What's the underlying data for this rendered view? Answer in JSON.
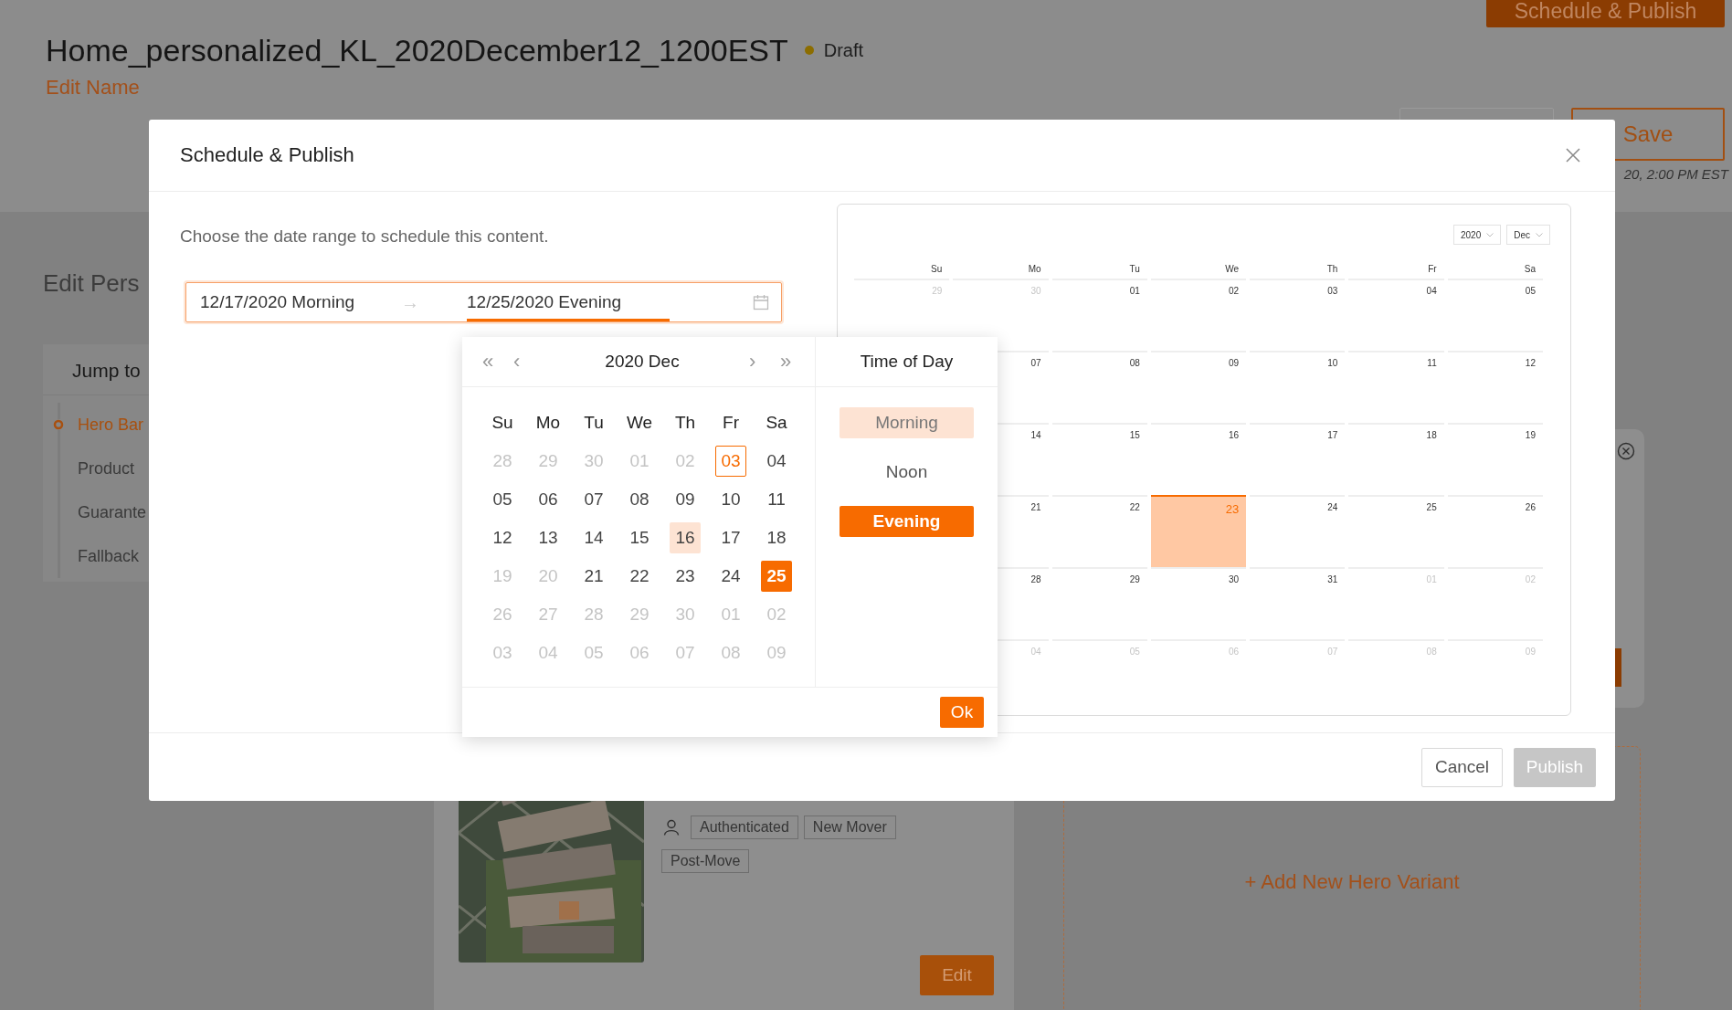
{
  "page": {
    "title": "Home_personalized_KL_2020December12_1200EST",
    "status": {
      "label": "Draft",
      "color": "#8c6d00"
    },
    "edit_link": "Edit Name",
    "schedule_button": "Schedule & Publish",
    "save_button": "Save",
    "last_saved": "20, 2:00 PM EST",
    "section_title": "Edit Pers",
    "jump_panel": {
      "title": "Jump to",
      "items": [
        {
          "label": "Hero Bar",
          "selected": true
        },
        {
          "label": "Product",
          "selected": false
        },
        {
          "label": "Guarante",
          "selected": false
        },
        {
          "label": "Fallback",
          "selected": false
        }
      ]
    },
    "hero_card": {
      "image": {
        "kind": "picture"
      },
      "tags": [
        "Authenticated",
        "New Mover",
        "Post-Move"
      ],
      "edit_button": "Edit"
    },
    "add_variant": "+ Add New Hero Variant"
  },
  "modal": {
    "title": "Schedule & Publish",
    "instruction": "Choose the date range to schedule this content.",
    "range": {
      "start": {
        "value": "12/17/2020 Morning",
        "selected": false
      },
      "separator": "→",
      "end": {
        "value": "12/25/2020 Evening",
        "selected": true
      }
    },
    "picker": {
      "nav": {
        "prev_year": "«",
        "prev_month": "‹",
        "label": "2020 Dec",
        "next_month": "›",
        "next_year": "»"
      },
      "weekdays": [
        "Su",
        "Mo",
        "Tu",
        "We",
        "Th",
        "Fr",
        "Sa"
      ],
      "days": [
        {
          "label": "28",
          "muted": true,
          "today": false,
          "hovered": false,
          "selected": false
        },
        {
          "label": "29",
          "muted": true,
          "today": false,
          "hovered": false,
          "selected": false
        },
        {
          "label": "30",
          "muted": true,
          "today": false,
          "hovered": false,
          "selected": false
        },
        {
          "label": "01",
          "muted": true,
          "today": false,
          "hovered": false,
          "selected": false
        },
        {
          "label": "02",
          "muted": true,
          "today": false,
          "hovered": false,
          "selected": false
        },
        {
          "label": "03",
          "muted": false,
          "today": true,
          "hovered": false,
          "selected": false
        },
        {
          "label": "04",
          "muted": false,
          "today": false,
          "hovered": false,
          "selected": false
        },
        {
          "label": "05",
          "muted": false,
          "today": false,
          "hovered": false,
          "selected": false
        },
        {
          "label": "06",
          "muted": false,
          "today": false,
          "hovered": false,
          "selected": false
        },
        {
          "label": "07",
          "muted": false,
          "today": false,
          "hovered": false,
          "selected": false
        },
        {
          "label": "08",
          "muted": false,
          "today": false,
          "hovered": false,
          "selected": false
        },
        {
          "label": "09",
          "muted": false,
          "today": false,
          "hovered": false,
          "selected": false
        },
        {
          "label": "10",
          "muted": false,
          "today": false,
          "hovered": false,
          "selected": false
        },
        {
          "label": "11",
          "muted": false,
          "today": false,
          "hovered": false,
          "selected": false
        },
        {
          "label": "12",
          "muted": false,
          "today": false,
          "hovered": false,
          "selected": false
        },
        {
          "label": "13",
          "muted": false,
          "today": false,
          "hovered": false,
          "selected": false
        },
        {
          "label": "14",
          "muted": false,
          "today": false,
          "hovered": false,
          "selected": false
        },
        {
          "label": "15",
          "muted": false,
          "today": false,
          "hovered": false,
          "selected": false
        },
        {
          "label": "16",
          "muted": false,
          "today": false,
          "hovered": true,
          "selected": false
        },
        {
          "label": "17",
          "muted": false,
          "today": false,
          "hovered": false,
          "selected": false
        },
        {
          "label": "18",
          "muted": false,
          "today": false,
          "hovered": false,
          "selected": false
        },
        {
          "label": "19",
          "muted": true,
          "today": false,
          "hovered": false,
          "selected": false
        },
        {
          "label": "20",
          "muted": true,
          "today": false,
          "hovered": false,
          "selected": false
        },
        {
          "label": "21",
          "muted": false,
          "today": false,
          "hovered": false,
          "selected": false
        },
        {
          "label": "22",
          "muted": false,
          "today": false,
          "hovered": false,
          "selected": false
        },
        {
          "label": "23",
          "muted": false,
          "today": false,
          "hovered": false,
          "selected": false
        },
        {
          "label": "24",
          "muted": false,
          "today": false,
          "hovered": false,
          "selected": false
        },
        {
          "label": "25",
          "muted": false,
          "today": false,
          "hovered": false,
          "selected": true
        },
        {
          "label": "26",
          "muted": true,
          "today": false,
          "hovered": false,
          "selected": false
        },
        {
          "label": "27",
          "muted": true,
          "today": false,
          "hovered": false,
          "selected": false
        },
        {
          "label": "28",
          "muted": true,
          "today": false,
          "hovered": false,
          "selected": false
        },
        {
          "label": "29",
          "muted": true,
          "today": false,
          "hovered": false,
          "selected": false
        },
        {
          "label": "30",
          "muted": true,
          "today": false,
          "hovered": false,
          "selected": false
        },
        {
          "label": "01",
          "muted": true,
          "today": false,
          "hovered": false,
          "selected": false
        },
        {
          "label": "02",
          "muted": true,
          "today": false,
          "hovered": false,
          "selected": false
        },
        {
          "label": "03",
          "muted": true,
          "today": false,
          "hovered": false,
          "selected": false
        },
        {
          "label": "04",
          "muted": true,
          "today": false,
          "hovered": false,
          "selected": false
        },
        {
          "label": "05",
          "muted": true,
          "today": false,
          "hovered": false,
          "selected": false
        },
        {
          "label": "06",
          "muted": true,
          "today": false,
          "hovered": false,
          "selected": false
        },
        {
          "label": "07",
          "muted": true,
          "today": false,
          "hovered": false,
          "selected": false
        },
        {
          "label": "08",
          "muted": true,
          "today": false,
          "hovered": false,
          "selected": false
        },
        {
          "label": "09",
          "muted": true,
          "today": false,
          "hovered": false,
          "selected": false
        }
      ],
      "time": {
        "title": "Time of Day",
        "options": [
          {
            "label": "Morning",
            "highlighted": true,
            "selected": false
          },
          {
            "label": "Noon",
            "highlighted": false,
            "selected": false
          },
          {
            "label": "Evening",
            "highlighted": false,
            "selected": true
          }
        ]
      },
      "ok_button": "Ok"
    },
    "preview": {
      "year": "2020",
      "month": "Dec",
      "columns": [
        {
          "weekday": "Su",
          "days": [
            {
              "label": "29",
              "muted": true,
              "selected": false
            }
          ]
        },
        {
          "weekday": "Mo",
          "days": [
            {
              "label": "30",
              "muted": true,
              "selected": false
            },
            {
              "label": "07",
              "muted": false,
              "selected": false
            },
            {
              "label": "14",
              "muted": false,
              "selected": false
            },
            {
              "label": "21",
              "muted": false,
              "selected": false
            },
            {
              "label": "28",
              "muted": false,
              "selected": false
            },
            {
              "label": "04",
              "muted": true,
              "selected": false
            }
          ]
        },
        {
          "weekday": "Tu",
          "days": [
            {
              "label": "01",
              "muted": false,
              "selected": false
            },
            {
              "label": "08",
              "muted": false,
              "selected": false
            },
            {
              "label": "15",
              "muted": false,
              "selected": false
            },
            {
              "label": "22",
              "muted": false,
              "selected": false
            },
            {
              "label": "29",
              "muted": false,
              "selected": false
            },
            {
              "label": "05",
              "muted": true,
              "selected": false
            }
          ]
        },
        {
          "weekday": "We",
          "days": [
            {
              "label": "02",
              "muted": false,
              "selected": false
            },
            {
              "label": "09",
              "muted": false,
              "selected": false
            },
            {
              "label": "16",
              "muted": false,
              "selected": false
            },
            {
              "label": "23",
              "muted": false,
              "selected": true
            },
            {
              "label": "30",
              "muted": false,
              "selected": false
            },
            {
              "label": "06",
              "muted": true,
              "selected": false
            }
          ]
        },
        {
          "weekday": "Th",
          "days": [
            {
              "label": "03",
              "muted": false,
              "selected": false
            },
            {
              "label": "10",
              "muted": false,
              "selected": false
            },
            {
              "label": "17",
              "muted": false,
              "selected": false
            },
            {
              "label": "24",
              "muted": false,
              "selected": false
            },
            {
              "label": "31",
              "muted": false,
              "selected": false
            },
            {
              "label": "07",
              "muted": true,
              "selected": false
            }
          ]
        },
        {
          "weekday": "Fr",
          "days": [
            {
              "label": "04",
              "muted": false,
              "selected": false
            },
            {
              "label": "11",
              "muted": false,
              "selected": false
            },
            {
              "label": "18",
              "muted": false,
              "selected": false
            },
            {
              "label": "25",
              "muted": false,
              "selected": false
            },
            {
              "label": "01",
              "muted": true,
              "selected": false
            },
            {
              "label": "08",
              "muted": true,
              "selected": false
            }
          ]
        },
        {
          "weekday": "Sa",
          "days": [
            {
              "label": "05",
              "muted": false,
              "selected": false
            },
            {
              "label": "12",
              "muted": false,
              "selected": false
            },
            {
              "label": "19",
              "muted": false,
              "selected": false
            },
            {
              "label": "26",
              "muted": false,
              "selected": false
            },
            {
              "label": "02",
              "muted": true,
              "selected": false
            },
            {
              "label": "09",
              "muted": true,
              "selected": false
            }
          ]
        }
      ]
    },
    "cancel_button": "Cancel",
    "publish_button": {
      "label": "Publish",
      "disabled": true
    }
  }
}
